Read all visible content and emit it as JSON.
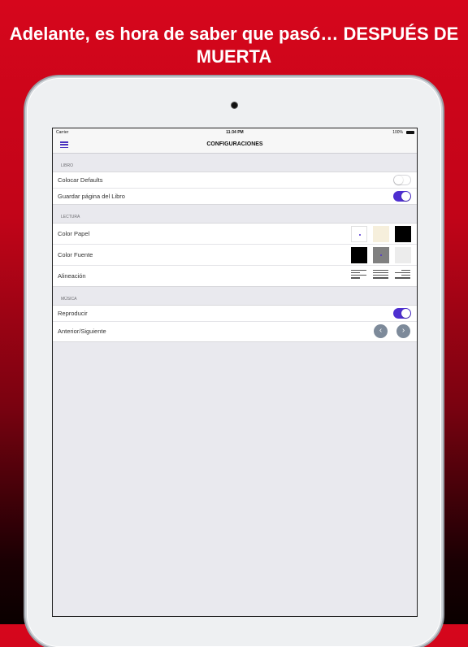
{
  "headline": "Adelante, es hora de saber que pasó… DESPUÉS DE MUERTA",
  "status_bar": {
    "carrier": "Carrier",
    "time": "11:34 PM",
    "battery": "100%"
  },
  "navbar": {
    "title": "CONFIGURACIONES",
    "menu_icon": "hamburger-icon"
  },
  "sections": {
    "libro": {
      "header": "LIBRO",
      "rows": [
        {
          "label": "Colocar Defaults",
          "toggle_on": false
        },
        {
          "label": "Guardar página del Libro",
          "toggle_on": true
        }
      ]
    },
    "lectura": {
      "header": "LECTURA",
      "color_papel": {
        "label": "Color Papel",
        "swatches": [
          "#ffffff",
          "#f6efdc",
          "#000000"
        ]
      },
      "color_fuente": {
        "label": "Color Fuente",
        "swatches": [
          "#000000",
          "#808080",
          "#ececec"
        ]
      },
      "alineacion": {
        "label": "Alineación",
        "options": [
          "align-left-icon",
          "align-justify-icon",
          "align-right-icon"
        ]
      }
    },
    "musica": {
      "header": "MÚSICA",
      "rows": [
        {
          "label": "Reproducir",
          "toggle_on": true
        },
        {
          "label": "Anterior/Siguiente",
          "buttons": [
            "chevron-left-icon",
            "chevron-right-icon"
          ]
        }
      ]
    }
  },
  "colors": {
    "accent": "#4e2fd0",
    "brand_red": "#d6061c",
    "nav_button": "#7d8a9a"
  }
}
